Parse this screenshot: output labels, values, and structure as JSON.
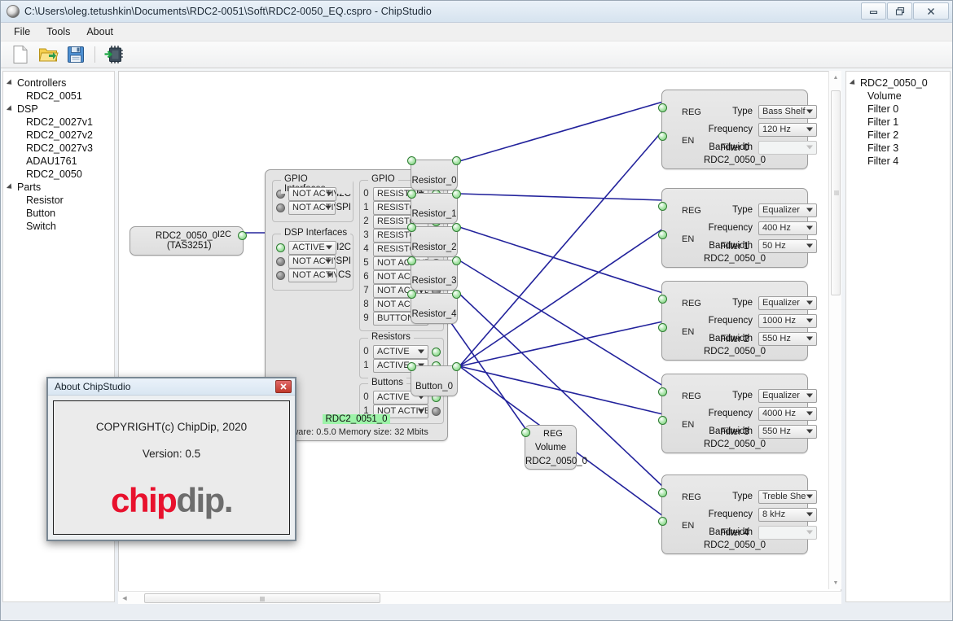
{
  "window": {
    "title": "C:\\Users\\oleg.tetushkin\\Documents\\RDC2-0051\\Soft\\RDC2-0050_EQ.cspro - ChipStudio",
    "minimize": "–",
    "restore": "❐",
    "close": "✕"
  },
  "menu": {
    "items": [
      "File",
      "Tools",
      "About"
    ]
  },
  "toolbar": {
    "items": [
      {
        "name": "new-file-icon",
        "title": "New"
      },
      {
        "name": "open-folder-icon",
        "title": "Open"
      },
      {
        "name": "save-icon",
        "title": "Save"
      },
      {
        "name": "program-chip-icon",
        "title": "Program"
      }
    ]
  },
  "left_tree": {
    "groups": [
      {
        "label": "Controllers",
        "children": [
          {
            "label": "RDC2_0051",
            "selected": false
          }
        ]
      },
      {
        "label": "DSP",
        "children": [
          {
            "label": "RDC2_0027v1",
            "selected": false
          },
          {
            "label": "RDC2_0027v2",
            "selected": false
          },
          {
            "label": "RDC2_0027v3",
            "selected": false
          },
          {
            "label": "ADAU1761",
            "selected": false
          },
          {
            "label": "RDC2_0050",
            "selected": true
          }
        ]
      },
      {
        "label": "Parts",
        "children": [
          {
            "label": "Resistor",
            "selected": false
          },
          {
            "label": "Button",
            "selected": false
          },
          {
            "label": "Switch",
            "selected": false
          }
        ]
      }
    ]
  },
  "right_tree": {
    "root": "RDC2_0050_0",
    "children": [
      "Volume",
      "Filter 0",
      "Filter 1",
      "Filter 2",
      "Filter 3",
      "Filter 4"
    ]
  },
  "dsp_node": {
    "port_label": "I2C",
    "name": "RDC2_0050_0",
    "chip": "(TAS3251)"
  },
  "gpio_window": {
    "gpio_interfaces": {
      "caption": "GPIO Interfaces",
      "rows": [
        {
          "state": "NOT ACTIVE",
          "side": "I2C",
          "active": false
        },
        {
          "state": "NOT ACTIVE",
          "side": "SPI",
          "active": false
        }
      ]
    },
    "dsp_interfaces": {
      "caption": "DSP Interfaces",
      "rows": [
        {
          "state": "ACTIVE",
          "side": "I2C",
          "active": true
        },
        {
          "state": "NOT ACTIVE",
          "side": "SPI",
          "active": false
        },
        {
          "state": "NOT ACTIVE",
          "side": "CS",
          "active": false
        }
      ]
    },
    "gpio": {
      "caption": "GPIO",
      "rows": [
        {
          "index": "0",
          "state": "RESISTOR",
          "active": true
        },
        {
          "index": "1",
          "state": "RESISTOR",
          "active": true
        },
        {
          "index": "2",
          "state": "RESISTOR",
          "active": true
        },
        {
          "index": "3",
          "state": "RESISTOR",
          "active": true
        },
        {
          "index": "4",
          "state": "RESISTOR",
          "active": true
        },
        {
          "index": "5",
          "state": "NOT ACTIVE",
          "active": false
        },
        {
          "index": "6",
          "state": "NOT ACTIVE",
          "active": false
        },
        {
          "index": "7",
          "state": "NOT ACTIVE",
          "active": false
        },
        {
          "index": "8",
          "state": "NOT ACTIVE",
          "active": false
        },
        {
          "index": "9",
          "state": "BUTTON",
          "active": true
        }
      ]
    },
    "resistors": {
      "caption": "Resistors",
      "rows": [
        {
          "index": "0",
          "state": "ACTIVE",
          "active": true
        },
        {
          "index": "1",
          "state": "ACTIVE",
          "active": true
        }
      ]
    },
    "buttons": {
      "caption": "Buttons",
      "rows": [
        {
          "index": "0",
          "state": "ACTIVE",
          "active": true
        },
        {
          "index": "1",
          "state": "NOT ACTIVE",
          "active": false
        }
      ]
    },
    "status_name": "RDC2_0051_0",
    "footer": "mware: 0.5.0   Memory size: 32 Mbits"
  },
  "parts": [
    {
      "label": "Resistor_0"
    },
    {
      "label": "Resistor_1"
    },
    {
      "label": "Resistor_2"
    },
    {
      "label": "Resistor_3"
    },
    {
      "label": "Resistor_4"
    },
    {
      "label": "Button_0"
    }
  ],
  "volume_node": {
    "port": "REG",
    "title": "Volume",
    "owner": "RDC2_0050_0"
  },
  "filter_labels": {
    "type": "Type",
    "frequency": "Frequency",
    "bandwidth": "Bandwidth",
    "reg": "REG",
    "en": "EN"
  },
  "filters": [
    {
      "title": "Filter 0",
      "owner": "RDC2_0050_0",
      "type": "Bass Shelf",
      "frequency": "120 Hz",
      "bandwidth": "",
      "bandwidth_enabled": false
    },
    {
      "title": "Filter 1",
      "owner": "RDC2_0050_0",
      "type": "Equalizer",
      "frequency": "400 Hz",
      "bandwidth": "50 Hz",
      "bandwidth_enabled": true
    },
    {
      "title": "Filter 2",
      "owner": "RDC2_0050_0",
      "type": "Equalizer",
      "frequency": "1000 Hz",
      "bandwidth": "550 Hz",
      "bandwidth_enabled": true
    },
    {
      "title": "Filter 3",
      "owner": "RDC2_0050_0",
      "type": "Equalizer",
      "frequency": "4000 Hz",
      "bandwidth": "550 Hz",
      "bandwidth_enabled": true
    },
    {
      "title": "Filter 4",
      "owner": "RDC2_0050_0",
      "type": "Treble She",
      "frequency": "8 kHz",
      "bandwidth": "",
      "bandwidth_enabled": false
    }
  ],
  "about": {
    "title": "About ChipStudio",
    "close": "✕",
    "copyright": "COPYRIGHT(c) ChipDip, 2020",
    "version": "Version: 0.5",
    "logo_a": "chip",
    "logo_b": "dip."
  },
  "colors": {
    "wire": "#23239c",
    "port_on": "#72cf72",
    "port_off": "#8e8e8e",
    "logo_red": "#e8112d",
    "logo_gray": "#6d6d6d",
    "highlight_green": "#9df3a8"
  }
}
